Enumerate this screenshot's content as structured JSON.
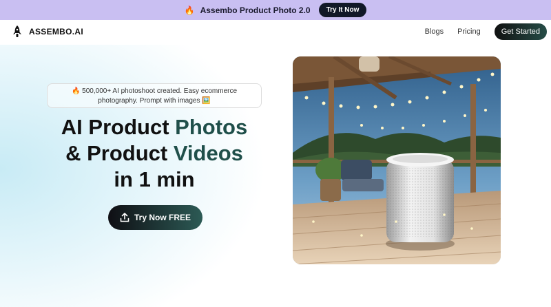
{
  "announcement": {
    "icon": "fire-icon",
    "text": "Assembo Product Photo 2.0",
    "button": "Try It Now"
  },
  "nav": {
    "brand": "ASSEMBO.AI",
    "links": [
      "Blogs",
      "Pricing"
    ],
    "cta": "Get Started"
  },
  "hero": {
    "pill_line1": "🔥 500,000+ AI photoshoot created. Easy ecommerce",
    "pill_line2": "photography. Prompt with images 🖼️",
    "headline": {
      "line1_a": "AI Product ",
      "line1_b": "Photos",
      "line2_a": "& Product ",
      "line2_b": "Videos",
      "line3": "in 1 min"
    },
    "button": "Try Now FREE",
    "image_subject": "white smart speaker on wooden deck with string lights"
  },
  "colors": {
    "announce_bg": "#c9bff2",
    "accent": "#1f4f4a",
    "dark": "#111827"
  }
}
